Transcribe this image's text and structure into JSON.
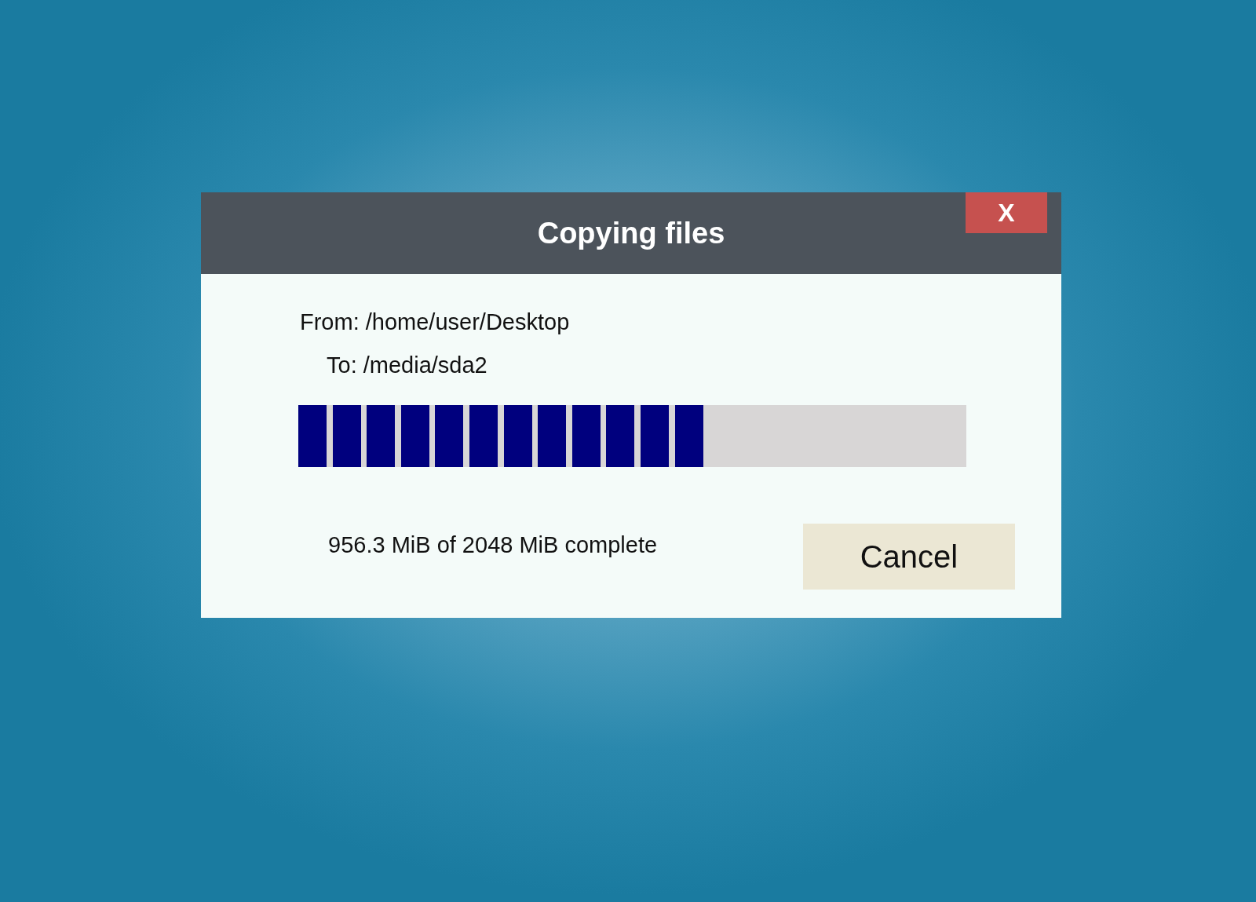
{
  "dialog": {
    "title": "Copying files",
    "close_label": "X"
  },
  "source": "From: /home/user/Desktop",
  "destination": "To: /media/sda2",
  "progress": {
    "level": 0.61
  },
  "status": "956.3 MiB of 2048 MiB complete",
  "buttons": [
    "Cancel"
  ]
}
